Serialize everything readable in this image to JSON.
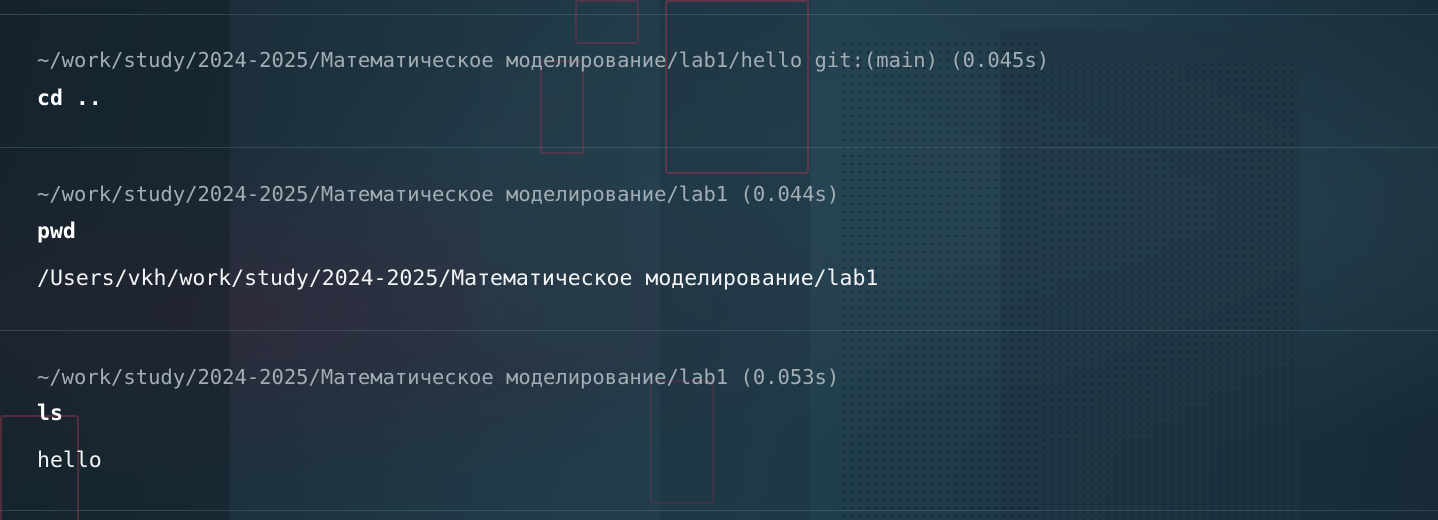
{
  "blocks": [
    {
      "prompt": "~/work/study/2024-2025/Математическое моделирование/lab1/hello git:(main) (0.045s)",
      "command": "cd ..",
      "output": ""
    },
    {
      "prompt": "~/work/study/2024-2025/Математическое моделирование/lab1 (0.044s)",
      "command": "pwd",
      "output": "/Users/vkh/work/study/2024-2025/Математическое моделирование/lab1"
    },
    {
      "prompt": "~/work/study/2024-2025/Математическое моделирование/lab1 (0.053s)",
      "command": "ls",
      "output": "hello"
    }
  ],
  "colors": {
    "prompt": "#a3adb4",
    "command": "#ffffff",
    "output": "#f2f4f5",
    "divider": "#4a6270"
  }
}
